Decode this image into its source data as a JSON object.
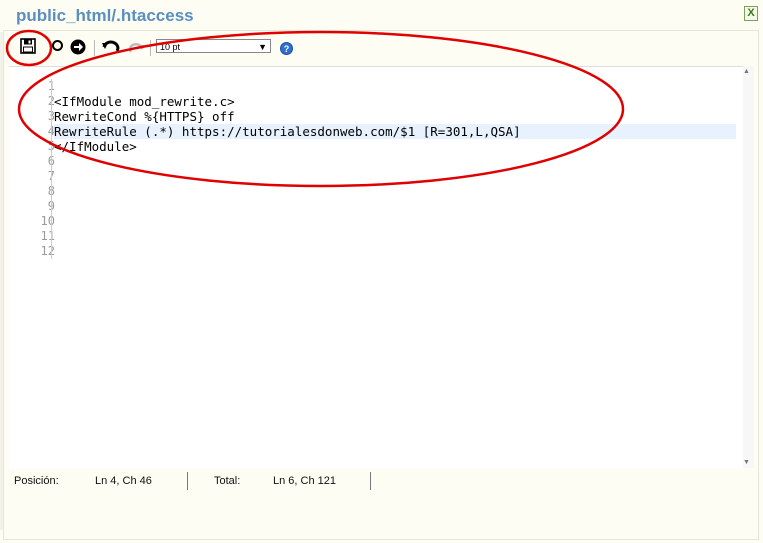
{
  "window": {
    "title": "public_html/.htaccess",
    "close_label": "X"
  },
  "toolbar": {
    "font_size_value": "10 pt",
    "help_label": "?",
    "icons": [
      "save-icon",
      "circle-icon",
      "forward-icon",
      "undo-icon",
      "redo-icon",
      "help-icon"
    ]
  },
  "editor": {
    "line_numbers": [
      "1",
      "2",
      "3",
      "4",
      "5",
      "6",
      "7",
      "8",
      "9",
      "10",
      "11",
      "12"
    ],
    "lines": [
      "",
      "<IfModule mod_rewrite.c>",
      "RewriteCond %{HTTPS} off",
      "RewriteRule (.*) https://tutorialesdonweb.com/$1 [R=301,L,QSA]",
      "</IfModule>",
      "",
      "",
      "",
      "",
      "",
      "",
      ""
    ],
    "active_line": 4
  },
  "status": {
    "position_label": "Posición:",
    "position_value": "Ln 4, Ch 46",
    "total_label": "Total:",
    "total_value": "Ln 6, Ch 121"
  },
  "colors": {
    "annotation": "#e00000",
    "title": "#5a8fc0",
    "active_line_bg": "#e8f2fe"
  }
}
